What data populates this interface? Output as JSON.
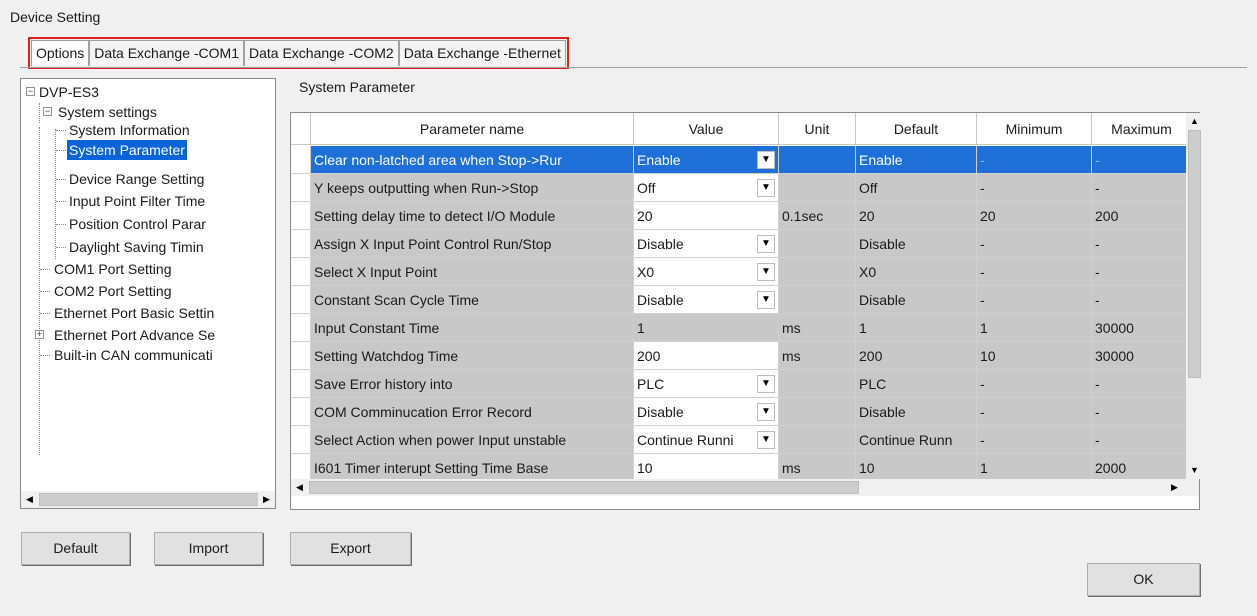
{
  "window": {
    "title": "Device Setting"
  },
  "tabs": [
    {
      "label": "Options"
    },
    {
      "label": "Data Exchange -COM1"
    },
    {
      "label": "Data Exchange -COM2"
    },
    {
      "label": "Data Exchange -Ethernet"
    }
  ],
  "tree": {
    "root": "DVP-ES3",
    "system_settings": "System settings",
    "items": [
      "System Information",
      "System Parameter",
      "Device Range Setting",
      "Input Point Filter Time",
      "Position Control Parar",
      "Daylight Saving Timin"
    ],
    "top_items": [
      "COM1 Port Setting",
      "COM2 Port Setting",
      "Ethernet Port Basic Settin",
      "Ethernet Port Advance Se",
      "Built-in CAN communicati"
    ],
    "selected": "System Parameter"
  },
  "section_title": "System Parameter",
  "grid": {
    "columns": [
      "Parameter name",
      "Value",
      "Unit",
      "Default",
      "Minimum",
      "Maximum"
    ],
    "rows": [
      {
        "name": "Clear non-latched area when Stop->Rur",
        "value": "Enable",
        "unit": "",
        "default": "Enable",
        "min": "-",
        "max": "-",
        "dropdown": true,
        "selected": true
      },
      {
        "name": "Y keeps outputting when Run->Stop",
        "value": "Off",
        "unit": "",
        "default": "Off",
        "min": "-",
        "max": "-",
        "dropdown": true
      },
      {
        "name": "Setting delay time to detect I/O Module",
        "value": "20",
        "unit": "0.1sec",
        "default": "20",
        "min": "20",
        "max": "200",
        "editable": true
      },
      {
        "name": "Assign X Input Point Control Run/Stop",
        "value": "Disable",
        "unit": "",
        "default": "Disable",
        "min": "-",
        "max": "-",
        "dropdown": true
      },
      {
        "name": "Select X Input Point",
        "value": "X0",
        "unit": "",
        "default": "X0",
        "min": "-",
        "max": "-",
        "dropdown": true
      },
      {
        "name": "Constant Scan Cycle Time",
        "value": "Disable",
        "unit": "",
        "default": "Disable",
        "min": "-",
        "max": "-",
        "dropdown": true
      },
      {
        "name": "Input Constant Time",
        "value": "1",
        "unit": "ms",
        "default": "1",
        "min": "1",
        "max": "30000"
      },
      {
        "name": "Setting Watchdog Time",
        "value": "200",
        "unit": "ms",
        "default": "200",
        "min": "10",
        "max": "30000",
        "editable": true
      },
      {
        "name": "Save Error history into",
        "value": "PLC",
        "unit": "",
        "default": "PLC",
        "min": "-",
        "max": "-",
        "dropdown": true
      },
      {
        "name": "COM Comminucation Error Record",
        "value": "Disable",
        "unit": "",
        "default": "Disable",
        "min": "-",
        "max": "-",
        "dropdown": true
      },
      {
        "name": "Select Action when power Input unstable",
        "value": "Continue Runni",
        "unit": "",
        "default": "Continue Runn",
        "min": "-",
        "max": "-",
        "dropdown": true
      },
      {
        "name": "I601 Timer interupt Setting Time Base",
        "value": "10",
        "unit": "ms",
        "default": "10",
        "min": "1",
        "max": "2000",
        "editable": true
      }
    ]
  },
  "buttons": {
    "default": "Default",
    "import": "Import",
    "export": "Export",
    "ok": "OK"
  },
  "colors": {
    "selection": "#1e6fd8",
    "tab_highlight": "#e02020",
    "readonly_cell": "#c8c8c8"
  }
}
